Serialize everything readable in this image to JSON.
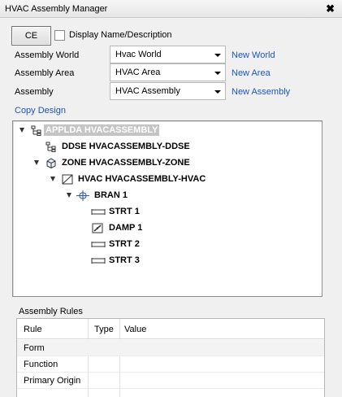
{
  "window": {
    "title": "HVAC Assembly Manager",
    "close_glyph": "✖"
  },
  "toolbar": {
    "ce_label": "CE",
    "display_name_label": "Display Name/Description",
    "display_name_checked": false
  },
  "fields": [
    {
      "label": "Assembly World",
      "value": "Hvac World",
      "link": "New World"
    },
    {
      "label": "Assembly Area",
      "value": "HVAC Area",
      "link": "New Area"
    },
    {
      "label": "Assembly",
      "value": "HVAC Assembly",
      "link": "New Assembly"
    }
  ],
  "copy_design": "Copy Design",
  "tree": [
    {
      "label": "APPLDA HVACASSEMBLY",
      "icon": "hierarchy-icon",
      "selected": true
    },
    {
      "label": "DDSE HVACASSEMBLY-DDSE",
      "icon": "hierarchy-icon"
    },
    {
      "label": "ZONE HVACASSEMBLY-ZONE",
      "icon": "cube-icon"
    },
    {
      "label": "HVAC HVACASSEMBLY-HVAC",
      "icon": "duct-icon"
    },
    {
      "label": "BRAN 1",
      "icon": "branch-icon"
    },
    {
      "label": "STRT 1",
      "icon": "straight-duct-icon"
    },
    {
      "label": "DAMP 1",
      "icon": "damper-icon"
    },
    {
      "label": "STRT 2",
      "icon": "straight-duct-icon"
    },
    {
      "label": "STRT 3",
      "icon": "straight-duct-icon"
    }
  ],
  "rules": {
    "title": "Assembly Rules",
    "columns": [
      "Rule",
      "Type",
      "Value"
    ],
    "rows": [
      "Form",
      "Function",
      "Primary Origin"
    ]
  }
}
